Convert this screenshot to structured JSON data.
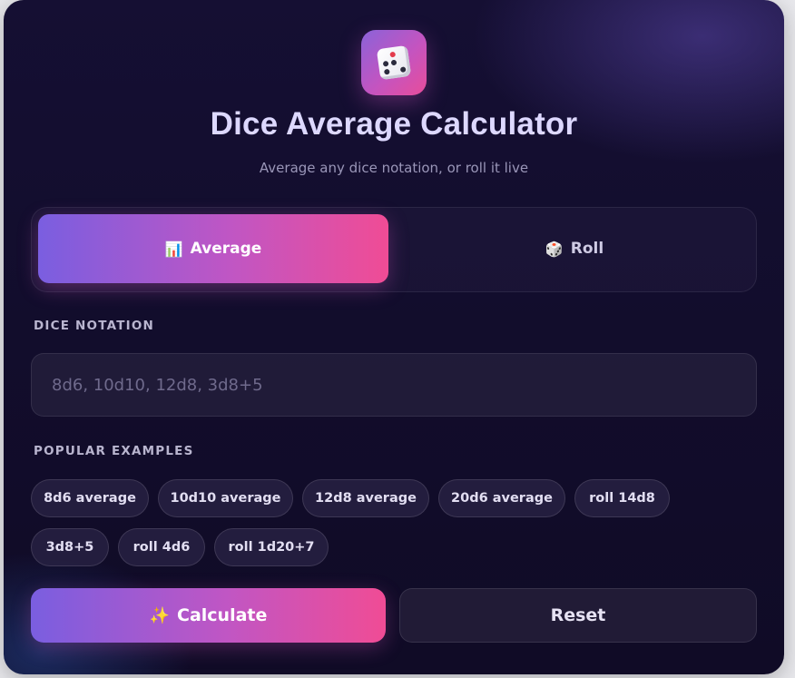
{
  "header": {
    "logo_icon": "dice-icon",
    "title": "Dice Average Calculator",
    "subtitle": "Average any dice notation, or roll it live"
  },
  "tabs": [
    {
      "icon": "chart-icon",
      "icon_glyph": "📊",
      "label": "Average",
      "active": true
    },
    {
      "icon": "dice-icon",
      "icon_glyph": "🎲",
      "label": "Roll",
      "active": false
    }
  ],
  "notation": {
    "label": "DICE NOTATION",
    "value": "",
    "placeholder": "8d6, 10d10, 12d8, 3d8+5"
  },
  "examples": {
    "label": "POPULAR EXAMPLES",
    "items": [
      "8d6 average",
      "10d10 average",
      "12d8 average",
      "20d6 average",
      "roll 14d8",
      "3d8+5",
      "roll 4d6",
      "roll 1d20+7"
    ]
  },
  "actions": {
    "calculate_icon": "sparkles-icon",
    "calculate_glyph": "✨",
    "calculate_label": "Calculate",
    "reset_label": "Reset"
  },
  "colors": {
    "accent_start": "#7a5ee0",
    "accent_end": "#f04c95",
    "background": "#140e30"
  }
}
